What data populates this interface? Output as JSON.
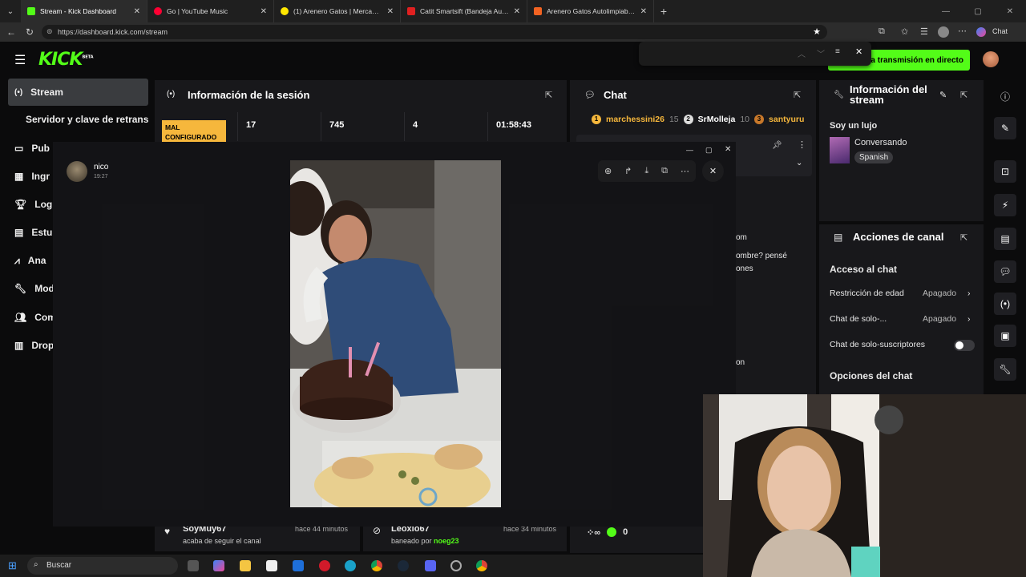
{
  "browser": {
    "tabs": [
      {
        "title": "Stream - Kick Dashboard",
        "color": "#53fc18"
      },
      {
        "title": "Go | YouTube Music",
        "color": "#ff0033"
      },
      {
        "title": "(1) Arenero Gatos | MercadoLibre 📦",
        "color": "#ffe600"
      },
      {
        "title": "Catit Smartsift (Bandeja Auto Limp",
        "color": "#e02020"
      },
      {
        "title": "Arenero Gatos Autolimpiable, Aren",
        "color": "#f26322"
      }
    ],
    "url": "https://dashboard.kick.com/stream",
    "copilot_label": "Chat"
  },
  "kick": {
    "logo": "KICK",
    "logo_badge": "BETA",
    "go_live": "a transmisión en directo"
  },
  "sidebar": {
    "items": [
      {
        "label": "Stream",
        "icon": "broadcast-icon"
      },
      {
        "label": "Servidor y clave de retransm",
        "icon": ""
      },
      {
        "label": "Pub",
        "icon": "monitor-icon"
      },
      {
        "label": "Ingr",
        "icon": "chart-icon"
      },
      {
        "label": "Logr",
        "icon": "trophy-icon"
      },
      {
        "label": "Estu",
        "icon": "book-icon"
      },
      {
        "label": "Ana",
        "icon": "analytics-icon"
      },
      {
        "label": "Mod",
        "icon": "wrench-icon"
      },
      {
        "label": "Com",
        "icon": "community-icon"
      },
      {
        "label": "Drop",
        "icon": "drops-icon"
      }
    ]
  },
  "session": {
    "title": "Información de la sesión",
    "badge": "MAL CONFIGURADO",
    "stats": [
      "17",
      "745",
      "4",
      "01:58:43"
    ]
  },
  "chat": {
    "title": "Chat",
    "top": [
      {
        "name": "marchessini26",
        "count": "15",
        "rank": "1"
      },
      {
        "name": "SrMolleja",
        "count": "10",
        "rank": "2"
      },
      {
        "name": "santyuru",
        "count": "",
        "rank": "3"
      }
    ],
    "visible_fragments": [
      "om",
      "ombre? pensé",
      "ones",
      "on"
    ]
  },
  "stream_info": {
    "title": "Información del stream",
    "stream_title": "Soy un lujo",
    "category": "Conversando",
    "language": "Spanish"
  },
  "channel_actions": {
    "title": "Acciones de canal",
    "section": "Acceso al chat",
    "rows": [
      {
        "label": "Restricción de edad",
        "value": "Apagado"
      },
      {
        "label": "Chat de solo-...",
        "value": "Apagado"
      },
      {
        "label": "Chat de solo-suscriptores",
        "value": ""
      }
    ],
    "options_title": "Opciones del chat"
  },
  "viewer": {
    "user": "nico",
    "time": "19:27"
  },
  "activity": [
    {
      "user": "SoyMuy67",
      "when": "hace 44 minutos",
      "desc": "acaba de seguir el canal",
      "extra": ""
    },
    {
      "user": "Leoxlo67",
      "when": "hace 34 minutos",
      "desc": "baneado por ",
      "extra": "noeg23"
    }
  ],
  "bottom_counter": {
    "value": "0"
  },
  "taskbar": {
    "search": "Buscar"
  },
  "colors": {
    "kick_green": "#53fc18",
    "panel": "#18181b",
    "warn": "#f6b73c"
  }
}
